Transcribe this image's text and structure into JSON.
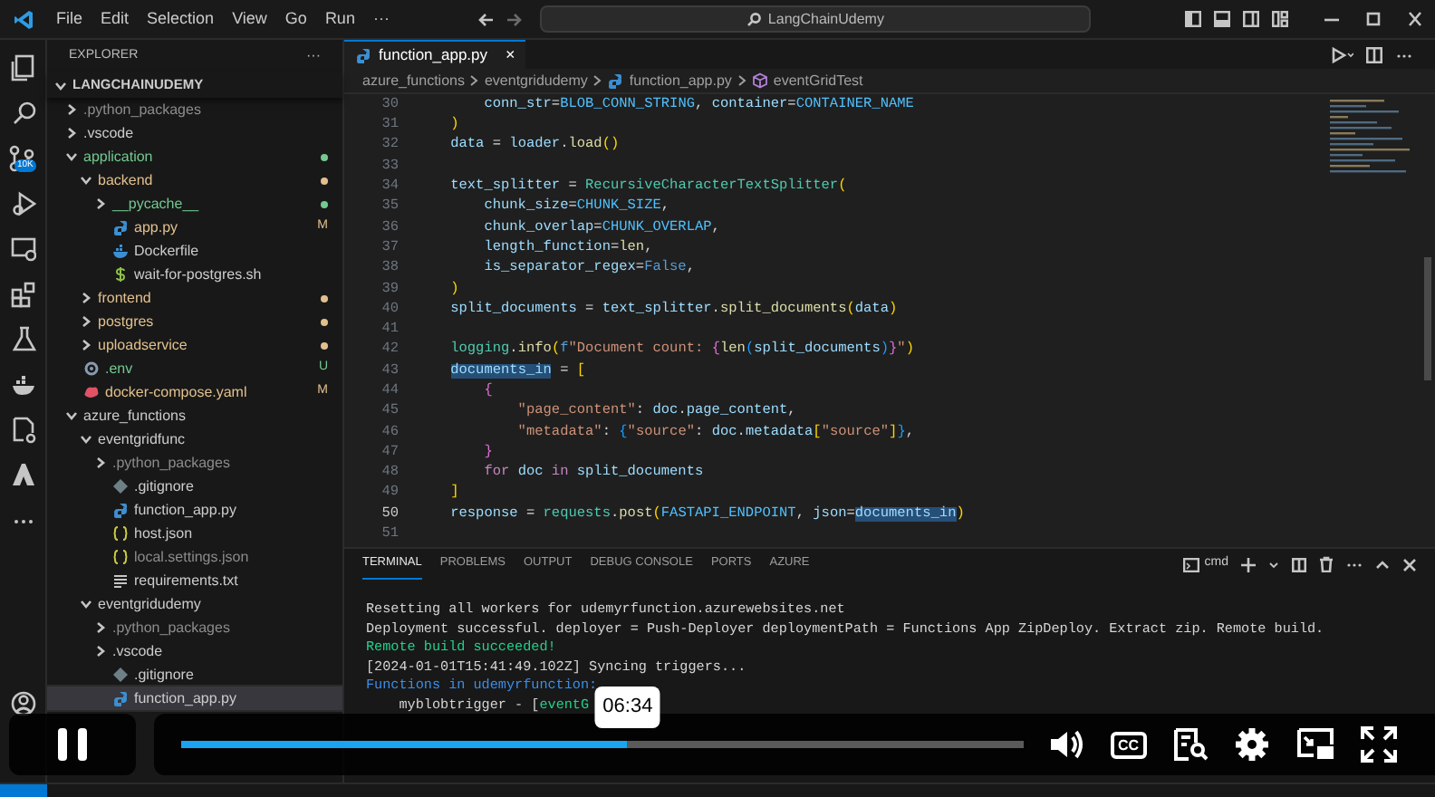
{
  "title_bar": {
    "menus": [
      "File",
      "Edit",
      "Selection",
      "View",
      "Go",
      "Run",
      "···"
    ],
    "search": "LangChainUdemy"
  },
  "activity_bar": {
    "badge": "10K"
  },
  "explorer": {
    "title": "EXPLORER",
    "more": "···",
    "root": "LANGCHAINUDEMY",
    "items": [
      {
        "name": ".python_packages",
        "kind": "folder",
        "expanded": false,
        "color": "#8c8c8c"
      },
      {
        "name": ".vscode",
        "kind": "folder",
        "expanded": false,
        "color": "#cccccc"
      },
      {
        "name": "application",
        "kind": "folder",
        "expanded": true,
        "color": "#73c991",
        "dot": true,
        "children": [
          {
            "name": "backend",
            "kind": "folder",
            "expanded": true,
            "color": "#e2c08d",
            "dot": true,
            "children": [
              {
                "name": "__pycache__",
                "kind": "folder",
                "expanded": false,
                "color": "#73c991",
                "dot": true
              },
              {
                "name": "app.py",
                "kind": "python",
                "color": "#e2c08d",
                "badge": "M"
              },
              {
                "name": "Dockerfile",
                "kind": "docker",
                "color": "#cccccc"
              },
              {
                "name": "wait-for-postgres.sh",
                "kind": "shell",
                "color": "#cccccc"
              }
            ]
          },
          {
            "name": "frontend",
            "kind": "folder",
            "expanded": false,
            "color": "#e2c08d",
            "dot": true
          },
          {
            "name": "postgres",
            "kind": "folder",
            "expanded": false,
            "color": "#e2c08d",
            "dot": true
          },
          {
            "name": "uploadservice",
            "kind": "folder",
            "expanded": false,
            "color": "#e2c08d",
            "dot": true
          }
        ]
      },
      {
        "name": ".env",
        "kind": "env",
        "color": "#73c991",
        "badge": "U"
      },
      {
        "name": "docker-compose.yaml",
        "kind": "yaml",
        "color": "#e2c08d",
        "badge": "M"
      },
      {
        "name": "azure_functions",
        "kind": "folder",
        "expanded": true,
        "color": "#cccccc",
        "children": [
          {
            "name": "eventgridfunc",
            "kind": "folder",
            "expanded": true,
            "color": "#cccccc",
            "children": [
              {
                "name": ".python_packages",
                "kind": "folder",
                "expanded": false,
                "color": "#8c8c8c"
              },
              {
                "name": ".gitignore",
                "kind": "git",
                "color": "#cccccc"
              },
              {
                "name": "function_app.py",
                "kind": "python",
                "color": "#cccccc"
              },
              {
                "name": "host.json",
                "kind": "json",
                "color": "#cccccc"
              },
              {
                "name": "local.settings.json",
                "kind": "json",
                "color": "#8c8c8c"
              },
              {
                "name": "requirements.txt",
                "kind": "text",
                "color": "#cccccc"
              }
            ]
          },
          {
            "name": "eventgridudemy",
            "kind": "folder",
            "expanded": true,
            "color": "#cccccc",
            "children": [
              {
                "name": ".python_packages",
                "kind": "folder",
                "expanded": false,
                "color": "#8c8c8c"
              },
              {
                "name": ".vscode",
                "kind": "folder",
                "expanded": false,
                "color": "#cccccc"
              },
              {
                "name": ".gitignore",
                "kind": "git",
                "color": "#cccccc"
              },
              {
                "name": "function_app.py",
                "kind": "python",
                "color": "#cccccc",
                "selected": true
              }
            ]
          }
        ]
      }
    ]
  },
  "editor": {
    "tab": "function_app.py",
    "tab_close": "×",
    "breadcrumbs": [
      "azure_functions",
      "eventgridudemy",
      "function_app.py",
      "eventGridTest"
    ],
    "lines": [
      {
        "number": "30",
        "active": false,
        "tokens": [
          {
            "text": "        conn_str",
            "kind": "v"
          },
          {
            "text": "=",
            "kind": "p"
          },
          {
            "text": "BLOB_CONN_STRING",
            "kind": "n"
          },
          {
            "text": ", ",
            "kind": "p"
          },
          {
            "text": "container",
            "kind": "v"
          },
          {
            "text": "=",
            "kind": "p"
          },
          {
            "text": "CONTAINER_NAME",
            "kind": "n"
          }
        ]
      },
      {
        "number": "31",
        "active": false,
        "tokens": [
          {
            "text": "    )",
            "kind": "b1"
          }
        ]
      },
      {
        "number": "32",
        "active": false,
        "tokens": [
          {
            "text": "    data",
            "kind": "v"
          },
          {
            "text": " = ",
            "kind": "p"
          },
          {
            "text": "loader",
            "kind": "v"
          },
          {
            "text": ".",
            "kind": "p"
          },
          {
            "text": "load",
            "kind": "f"
          },
          {
            "text": "()",
            "kind": "b1"
          }
        ]
      },
      {
        "number": "33",
        "active": false
      },
      {
        "number": "34",
        "active": false,
        "tokens": [
          {
            "text": "    text_splitter",
            "kind": "v"
          },
          {
            "text": " = ",
            "kind": "p"
          },
          {
            "text": "RecursiveCharacterTextSplitter",
            "kind": "c"
          },
          {
            "text": "(",
            "kind": "b1"
          }
        ]
      },
      {
        "number": "35",
        "active": false,
        "tokens": [
          {
            "text": "        chunk_size",
            "kind": "v"
          },
          {
            "text": "=",
            "kind": "p"
          },
          {
            "text": "CHUNK_SIZE",
            "kind": "n"
          },
          {
            "text": ",",
            "kind": "p"
          }
        ]
      },
      {
        "number": "36",
        "active": false,
        "tokens": [
          {
            "text": "        chunk_overlap",
            "kind": "v"
          },
          {
            "text": "=",
            "kind": "p"
          },
          {
            "text": "CHUNK_OVERLAP",
            "kind": "n"
          },
          {
            "text": ",",
            "kind": "p"
          }
        ]
      },
      {
        "number": "37",
        "active": false,
        "tokens": [
          {
            "text": "        length_function",
            "kind": "v"
          },
          {
            "text": "=",
            "kind": "p"
          },
          {
            "text": "len",
            "kind": "f"
          },
          {
            "text": ",",
            "kind": "p"
          }
        ]
      },
      {
        "number": "38",
        "active": false,
        "tokens": [
          {
            "text": "        is_separator_regex",
            "kind": "v"
          },
          {
            "text": "=",
            "kind": "p"
          },
          {
            "text": "False",
            "kind": "k"
          },
          {
            "text": ",",
            "kind": "p"
          }
        ]
      },
      {
        "number": "39",
        "active": false,
        "tokens": [
          {
            "text": "    )",
            "kind": "b1"
          }
        ]
      },
      {
        "number": "40",
        "active": false,
        "tokens": [
          {
            "text": "    split_documents",
            "kind": "v"
          },
          {
            "text": " = ",
            "kind": "p"
          },
          {
            "text": "text_splitter",
            "kind": "v"
          },
          {
            "text": ".",
            "kind": "p"
          },
          {
            "text": "split_documents",
            "kind": "f"
          },
          {
            "text": "(",
            "kind": "b1"
          },
          {
            "text": "data",
            "kind": "v"
          },
          {
            "text": ")",
            "kind": "b1"
          }
        ]
      },
      {
        "number": "41",
        "active": false
      },
      {
        "number": "42",
        "active": false,
        "tokens": [
          {
            "text": "    logging",
            "kind": "c"
          },
          {
            "text": ".",
            "kind": "p"
          },
          {
            "text": "info",
            "kind": "f"
          },
          {
            "text": "(",
            "kind": "b1"
          },
          {
            "text": "f",
            "kind": "k"
          },
          {
            "text": "\"Document count: ",
            "kind": "s"
          },
          {
            "text": "{",
            "kind": "b2"
          },
          {
            "text": "len",
            "kind": "f"
          },
          {
            "text": "(",
            "kind": "b3"
          },
          {
            "text": "split_documents",
            "kind": "v"
          },
          {
            "text": ")",
            "kind": "b3"
          },
          {
            "text": "}",
            "kind": "b2"
          },
          {
            "text": "\"",
            "kind": "s"
          },
          {
            "text": ")",
            "kind": "b1"
          }
        ]
      },
      {
        "number": "43",
        "active": false,
        "tokens": [
          {
            "text": "    documents_in",
            "kind": "sel"
          },
          {
            "text": " = ",
            "kind": "p"
          },
          {
            "text": "[",
            "kind": "b1"
          }
        ]
      },
      {
        "number": "44",
        "active": false,
        "tokens": [
          {
            "text": "        {",
            "kind": "b2"
          }
        ]
      },
      {
        "number": "45",
        "active": false,
        "tokens": [
          {
            "text": "            \"page_content\"",
            "kind": "s"
          },
          {
            "text": ": ",
            "kind": "p"
          },
          {
            "text": "doc",
            "kind": "v"
          },
          {
            "text": ".",
            "kind": "p"
          },
          {
            "text": "page_content",
            "kind": "v"
          },
          {
            "text": ",",
            "kind": "p"
          }
        ]
      },
      {
        "number": "46",
        "active": false,
        "tokens": [
          {
            "text": "            \"metadata\"",
            "kind": "s"
          },
          {
            "text": ": ",
            "kind": "p"
          },
          {
            "text": "{",
            "kind": "b3"
          },
          {
            "text": "\"source\"",
            "kind": "s"
          },
          {
            "text": ": ",
            "kind": "p"
          },
          {
            "text": "doc",
            "kind": "v"
          },
          {
            "text": ".",
            "kind": "p"
          },
          {
            "text": "metadata",
            "kind": "v"
          },
          {
            "text": "[",
            "kind": "b1"
          },
          {
            "text": "\"source\"",
            "kind": "s"
          },
          {
            "text": "]",
            "kind": "b1"
          },
          {
            "text": "}",
            "kind": "b3"
          },
          {
            "text": ",",
            "kind": "p"
          }
        ]
      },
      {
        "number": "47",
        "active": false,
        "tokens": [
          {
            "text": "        }",
            "kind": "b2"
          }
        ]
      },
      {
        "number": "48",
        "active": false,
        "tokens": [
          {
            "text": "        for ",
            "kind": "w"
          },
          {
            "text": "doc ",
            "kind": "v"
          },
          {
            "text": "in ",
            "kind": "w"
          },
          {
            "text": "split_documents",
            "kind": "v"
          }
        ]
      },
      {
        "number": "49",
        "active": false,
        "tokens": [
          {
            "text": "    ]",
            "kind": "b1"
          }
        ]
      },
      {
        "number": "50",
        "active": true,
        "tokens": [
          {
            "text": "    response",
            "kind": "v"
          },
          {
            "text": " = ",
            "kind": "p"
          },
          {
            "text": "requests",
            "kind": "c"
          },
          {
            "text": ".",
            "kind": "p"
          },
          {
            "text": "post",
            "kind": "f"
          },
          {
            "text": "(",
            "kind": "b1"
          },
          {
            "text": "FASTAPI_ENDPOINT",
            "kind": "n"
          },
          {
            "text": ", ",
            "kind": "p"
          },
          {
            "text": "json",
            "kind": "v"
          },
          {
            "text": "=",
            "kind": "p"
          },
          {
            "text": "documents_in",
            "kind": "sel"
          },
          {
            "text": ")",
            "kind": "b1"
          }
        ]
      },
      {
        "number": "51",
        "active": false
      }
    ]
  },
  "panel": {
    "tabs": [
      {
        "label": "TERMINAL",
        "selected": true
      },
      {
        "label": "PROBLEMS",
        "selected": false
      },
      {
        "label": "OUTPUT",
        "selected": false
      },
      {
        "label": "DEBUG CONSOLE",
        "selected": false
      },
      {
        "label": "PORTS",
        "selected": false
      },
      {
        "label": "AZURE",
        "selected": false
      }
    ],
    "shell": "cmd",
    "lines": [
      {
        "tokens": [
          {
            "text": "Resetting all workers for udemyrfunction.azurewebsites.net",
            "kind": "p"
          }
        ]
      },
      {
        "tokens": [
          {
            "text": "Deployment successful. deployer = Push-Deployer deploymentPath = Functions App ZipDeploy. Extract zip. Remote build.",
            "kind": "p"
          }
        ]
      },
      {
        "tokens": [
          {
            "text": "Remote build succeeded!",
            "kind": "ok"
          }
        ]
      },
      {
        "tokens": [
          {
            "text": "[2024-01-01T15:41:49.102Z] Syncing triggers...",
            "kind": "p"
          }
        ]
      },
      {
        "tokens": [
          {
            "text": "Functions in udemyrfunction:",
            "kind": "info"
          }
        ]
      },
      {
        "tokens": [
          {
            "text": "    myblobtrigger - [",
            "kind": "p"
          },
          {
            "text": "eventG",
            "kind": "ok"
          }
        ]
      }
    ]
  },
  "player": {
    "playing": true,
    "level": 0.53,
    "time": "06:34",
    "captions": "CC"
  }
}
